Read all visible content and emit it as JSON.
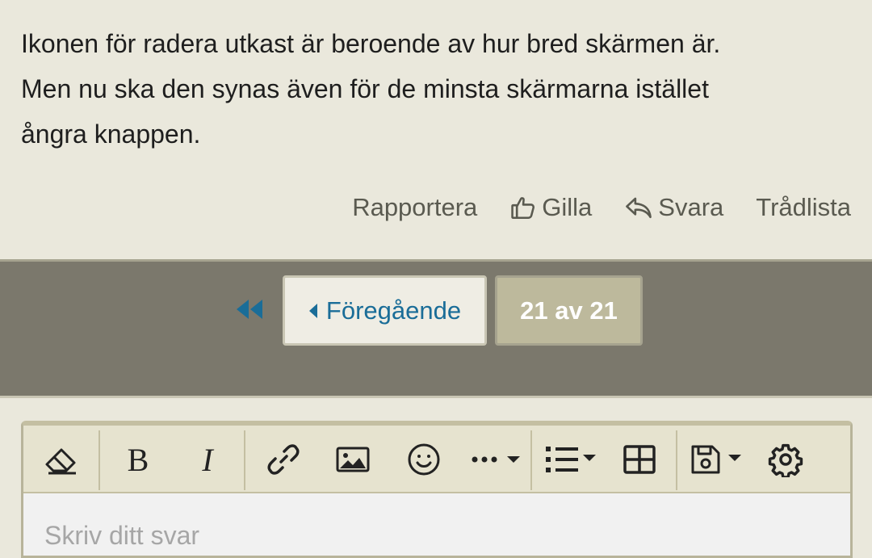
{
  "post": {
    "lines": [
      "Ikonen för radera utkast är beroende av hur bred skärmen är.",
      "Men nu ska den synas även för de minsta skärmarna istället",
      "ångra knappen."
    ],
    "actions": {
      "report": "Rapportera",
      "like": "Gilla",
      "reply": "Svara",
      "thread_list": "Trådlista"
    }
  },
  "pagination": {
    "previous_label": "Föregående",
    "current": "21 av 21"
  },
  "editor": {
    "placeholder": "Skriv ditt svar",
    "toolbar_icons": [
      "eraser-icon",
      "bold-icon",
      "italic-icon",
      "link-icon",
      "image-icon",
      "smiley-icon",
      "more-icon",
      "list-icon",
      "table-icon",
      "save-icon",
      "settings-icon"
    ]
  },
  "colors": {
    "background": "#eae8dc",
    "pagebar": "#7b786c",
    "link": "#1a6d98",
    "current_page": "#bdb99c",
    "toolbar": "#e6e3cf"
  }
}
